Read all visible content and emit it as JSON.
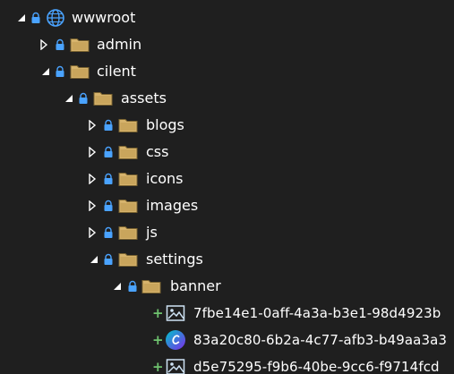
{
  "explorer": {
    "root": {
      "label": "wwwroot",
      "icon": "globe-icon",
      "state": "expanded"
    },
    "folders": {
      "admin": {
        "label": "admin",
        "state": "collapsed"
      },
      "cilent": {
        "label": "cilent",
        "state": "expanded"
      },
      "assets": {
        "label": "assets",
        "state": "expanded"
      },
      "blogs": {
        "label": "blogs",
        "state": "collapsed"
      },
      "css": {
        "label": "css",
        "state": "collapsed"
      },
      "icons": {
        "label": "icons",
        "state": "collapsed"
      },
      "images": {
        "label": "images",
        "state": "collapsed"
      },
      "js": {
        "label": "js",
        "state": "collapsed"
      },
      "settings": {
        "label": "settings",
        "state": "expanded"
      },
      "banner": {
        "label": "banner",
        "state": "expanded"
      }
    },
    "files": [
      {
        "label": "7fbe14e1-0aff-4a3a-b3e1-98d4923b",
        "icon": "image-file-icon",
        "status": "+"
      },
      {
        "label": "83a20c80-6b2a-4c77-afb3-b49aa3a3",
        "icon": "canva-file-icon",
        "status": "+"
      },
      {
        "label": "d5e75295-f9b6-40be-9cc6-f9714fcd",
        "icon": "image-file-icon",
        "status": "+"
      }
    ]
  },
  "colors": {
    "background": "#1f1f1f",
    "text": "#ffffff",
    "folder_fill": "#d6b36c",
    "lock": "#4aa3ff",
    "added_status": "#6fc36f",
    "canva_gradient_start": "#00c4cc",
    "canva_gradient_end": "#7d2ae8"
  }
}
